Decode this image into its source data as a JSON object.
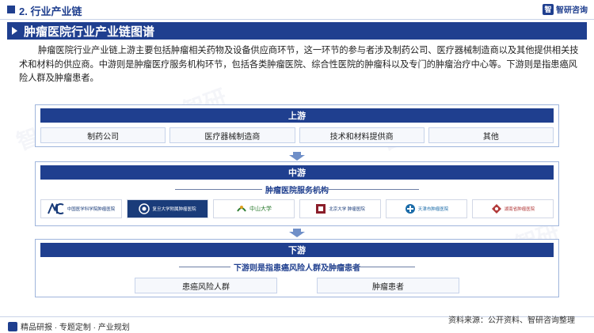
{
  "header": {
    "section_title": "2. 行业产业链",
    "brand": "智研咨询"
  },
  "banner": {
    "title": "肿瘤医院行业产业链图谱"
  },
  "intro": "肿瘤医院行业产业链上游主要包括肿瘤相关药物及设备供应商环节，这一环节的参与者涉及制药公司、医疗器械制造商以及其他提供相关技术和材料的供应商。中游则是肿瘤医疗服务机构环节，包括各类肿瘤医院、综合性医院的肿瘤科以及专门的肿瘤治疗中心等。下游则是指患癌风险人群及肿瘤患者。",
  "upstream": {
    "title": "上游",
    "items": [
      "制药公司",
      "医疗器械制造商",
      "技术和材料提供商",
      "其他"
    ]
  },
  "midstream": {
    "title": "中游",
    "sub_label": "肿瘤医院服务机构",
    "logos": [
      {
        "text": "中国医学科学院肿瘤医院",
        "color": "#1a3c7a"
      },
      {
        "text": "复旦大学附属肿瘤医院",
        "color": "#1a3c7a"
      },
      {
        "text": "中山大学",
        "color": "#2e7d32"
      },
      {
        "text": "北京大学 肿瘤医院",
        "color": "#1a3c7a"
      },
      {
        "text": "天津市肿瘤医院",
        "color": "#1a6ba8"
      },
      {
        "text": "湖南省肿瘤医院",
        "color": "#b23a3a"
      }
    ]
  },
  "downstream": {
    "title": "下游",
    "sub_label": "下游则是指患癌风险人群及肿瘤患者",
    "items": [
      "患癌风险人群",
      "肿瘤患者"
    ]
  },
  "footer": {
    "left": "精品研报 · 专题定制 · 产业规划",
    "right": "资料来源：公开资料、智研咨询整理"
  }
}
